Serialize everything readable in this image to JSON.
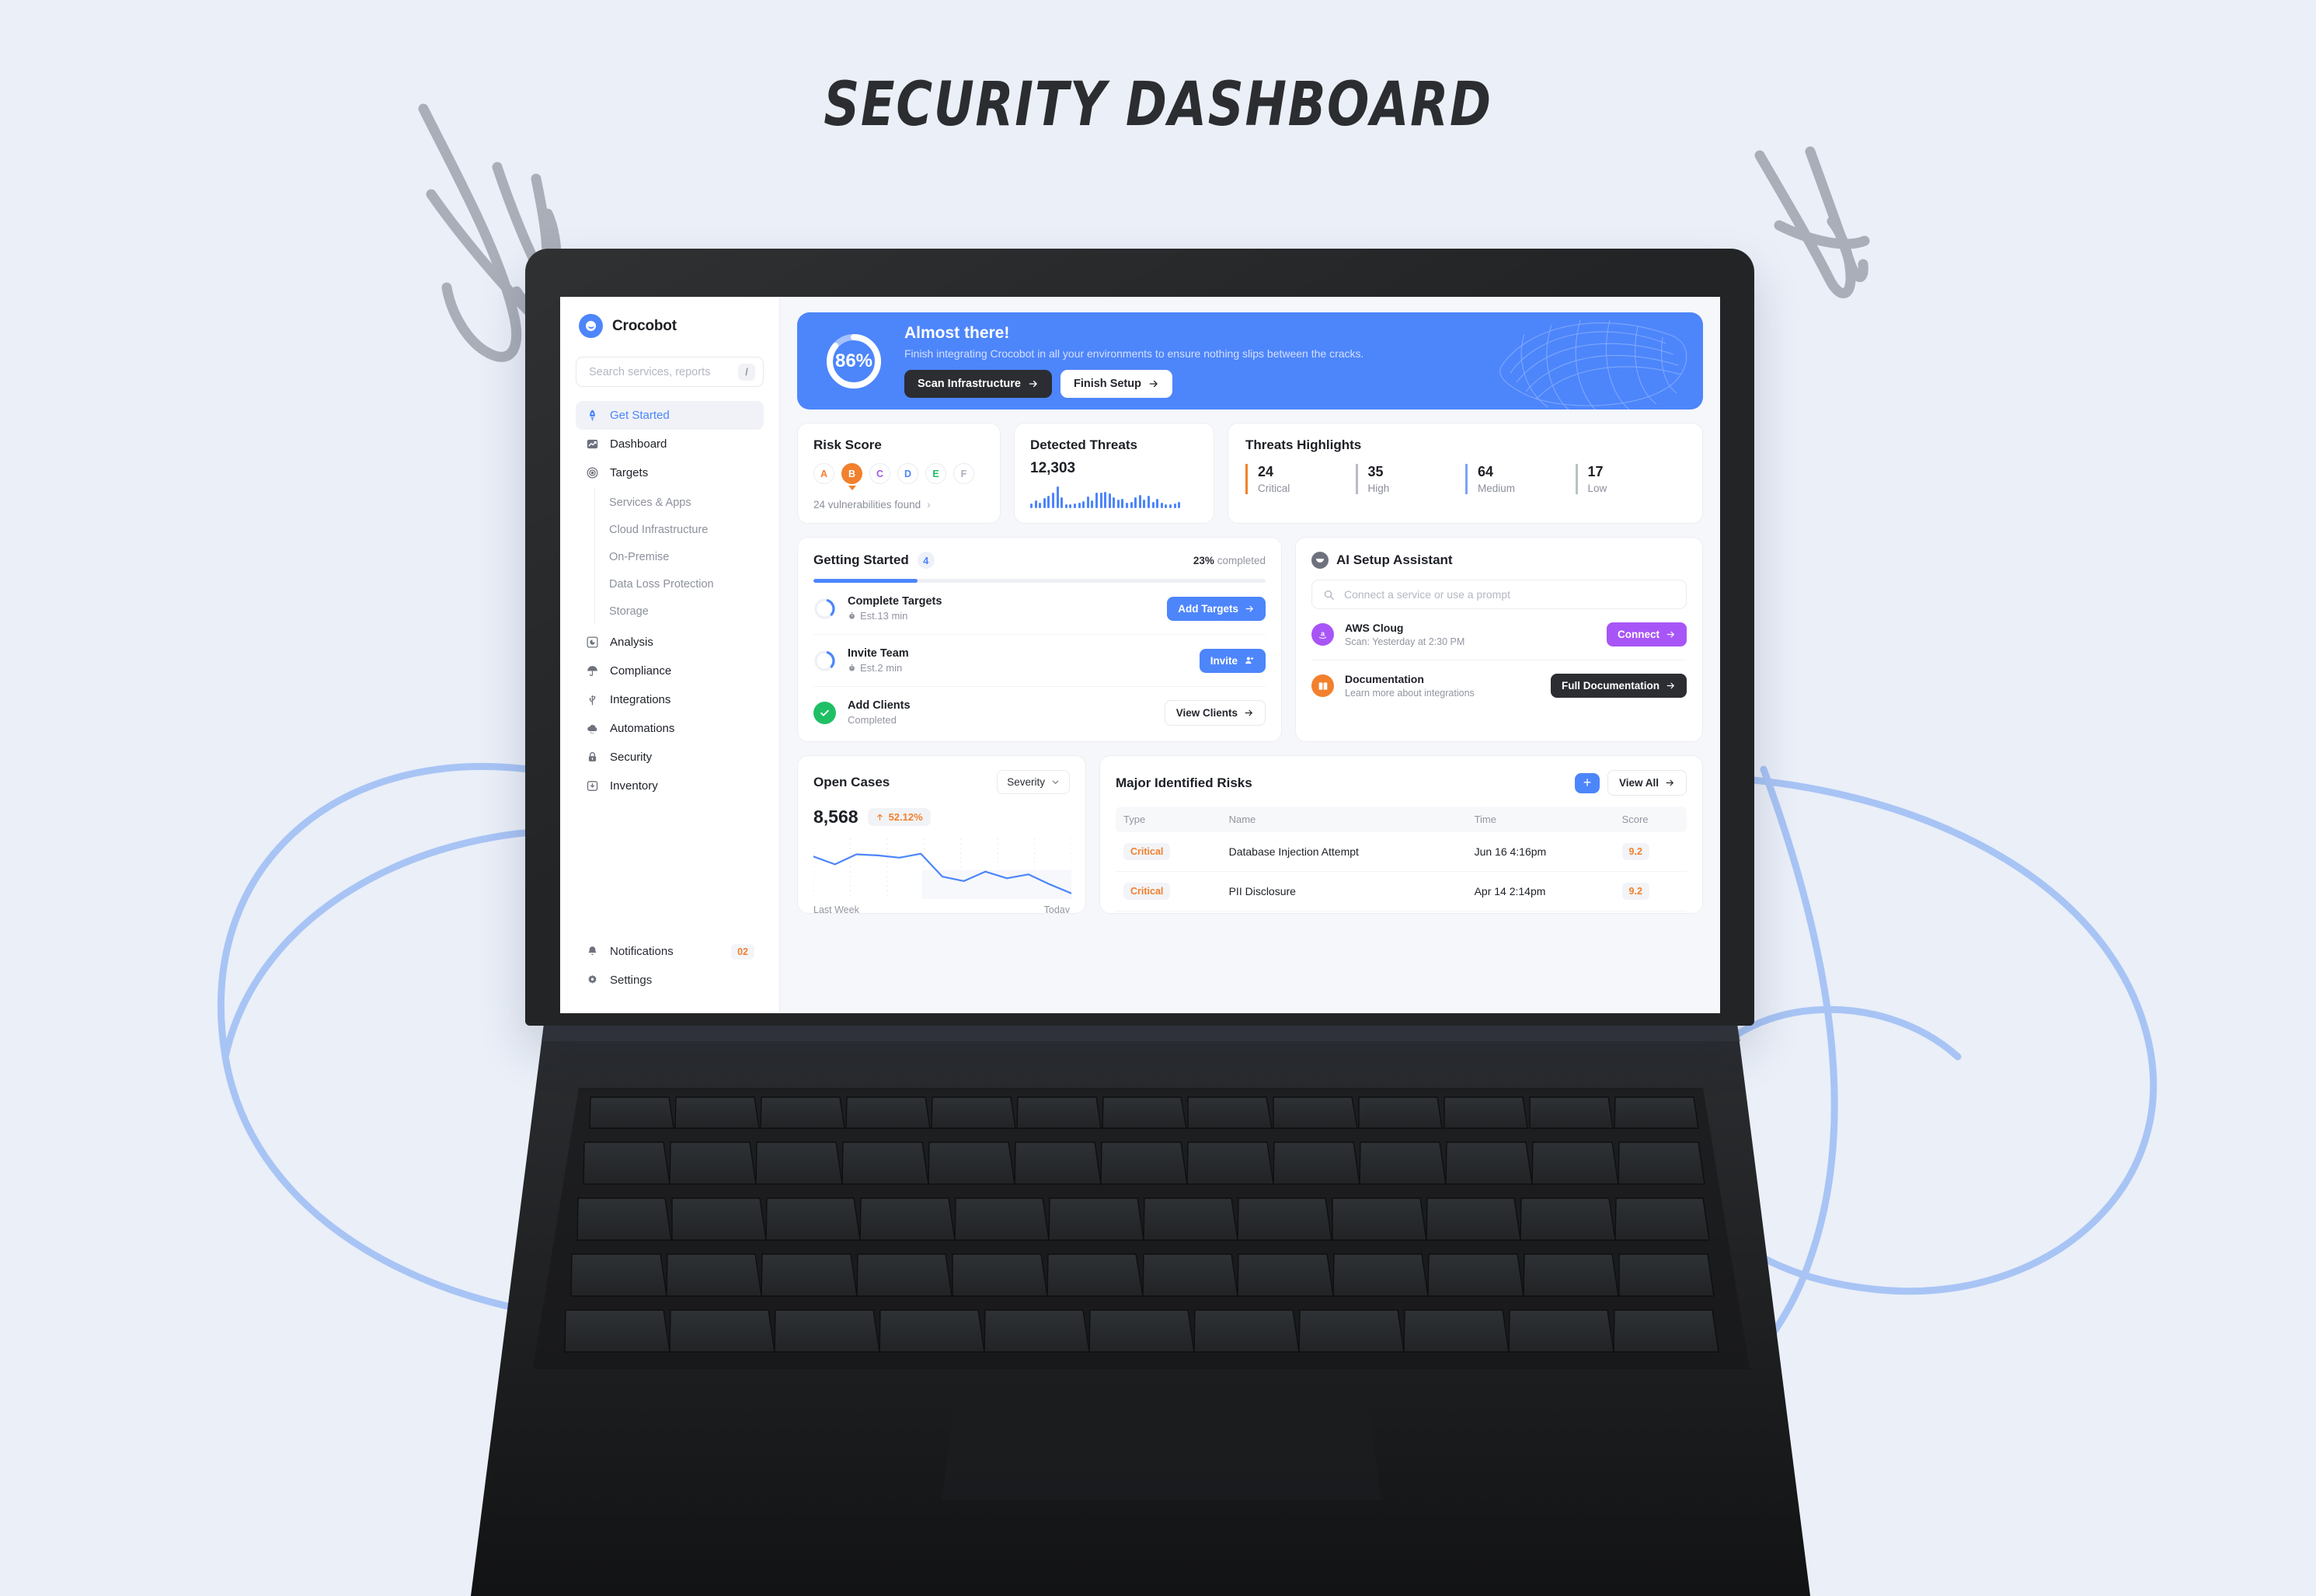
{
  "page": {
    "title": "SECURITY DASHBOARD"
  },
  "colors": {
    "accent_blue": "#4d85fb",
    "dark": "#2b2d32",
    "orange": "#f2802c",
    "green": "#1fc065",
    "purple": "#a855f7",
    "page_bg": "#eaeff8",
    "decor_line": "#a8c4f5"
  },
  "sidebar": {
    "brand": "Crocobot",
    "search": {
      "placeholder": "Search services, reports",
      "value": "",
      "shortcut": "/"
    },
    "items": [
      {
        "label": "Get Started",
        "icon": "rocket-icon",
        "active": true
      },
      {
        "label": "Dashboard",
        "icon": "chart-icon",
        "active": false
      },
      {
        "label": "Targets",
        "icon": "target-icon",
        "active": false
      }
    ],
    "subitems": [
      {
        "label": "Services & Apps"
      },
      {
        "label": "Cloud Infrastructure"
      },
      {
        "label": "On-Premise"
      },
      {
        "label": "Data Loss Protection"
      },
      {
        "label": "Storage"
      }
    ],
    "items2": [
      {
        "label": "Analysis",
        "icon": "pie-icon"
      },
      {
        "label": "Compliance",
        "icon": "umbrella-icon"
      },
      {
        "label": "Integrations",
        "icon": "usb-icon"
      },
      {
        "label": "Automations",
        "icon": "cloud-icon"
      },
      {
        "label": "Security",
        "icon": "lock-icon"
      },
      {
        "label": "Inventory",
        "icon": "inbox-icon"
      }
    ],
    "bottom": [
      {
        "label": "Notifications",
        "icon": "bell-icon",
        "badge": "02"
      },
      {
        "label": "Settings",
        "icon": "gear-icon",
        "badge": ""
      }
    ]
  },
  "banner": {
    "percent": "86%",
    "percent_value": 86,
    "title": "Almost there!",
    "subtitle": "Finish integrating Crocobot in all your environments to ensure nothing slips between the cracks.",
    "primary_button": "Scan Infrastructure",
    "secondary_button": "Finish Setup"
  },
  "risk_score": {
    "title": "Risk Score",
    "grades": [
      {
        "letter": "A",
        "color": "#f2802c",
        "selected": false
      },
      {
        "letter": "B",
        "color": "#f2802c",
        "selected": true
      },
      {
        "letter": "C",
        "color": "#9b5de5",
        "selected": false
      },
      {
        "letter": "D",
        "color": "#4d85fb",
        "selected": false
      },
      {
        "letter": "E",
        "color": "#1fc065",
        "selected": false
      },
      {
        "letter": "F",
        "color": "#a9adb8",
        "selected": false
      }
    ],
    "footer": "24 vulnerabilities found"
  },
  "detected_threats": {
    "title": "Detected Threats",
    "value": "12,303"
  },
  "threats_highlights": {
    "title": "Threats Highlights",
    "items": [
      {
        "count": "24",
        "label": "Critical",
        "color": "#f2802c"
      },
      {
        "count": "35",
        "label": "High",
        "color": "#b9bcc4"
      },
      {
        "count": "64",
        "label": "Medium",
        "color": "#7aa5f7"
      },
      {
        "count": "17",
        "label": "Low",
        "color": "#b9c4bd"
      }
    ]
  },
  "getting_started": {
    "title": "Getting Started",
    "count": "4",
    "completed_pct": "23%",
    "completed_label": "completed",
    "progress_value": 23,
    "items": [
      {
        "name": "Complete Targets",
        "meta": "Est.13 min",
        "meta_icon": "timer-icon",
        "state": "pending",
        "button": "Add Targets",
        "button_style": "blue",
        "button_icon": "arrow-right-icon"
      },
      {
        "name": "Invite Team",
        "meta": "Est.2 min",
        "meta_icon": "timer-icon",
        "state": "pending",
        "button": "Invite",
        "button_style": "blue",
        "button_icon": "user-plus-icon"
      },
      {
        "name": "Add Clients",
        "meta": "Completed",
        "meta_icon": "",
        "state": "completed",
        "button": "View Clients",
        "button_style": "outline",
        "button_icon": "arrow-right-icon"
      }
    ]
  },
  "ai_assistant": {
    "title": "AI Setup Assistant",
    "search": {
      "placeholder": "Connect a service or use a prompt",
      "value": ""
    },
    "items": [
      {
        "name": "AWS Cloug",
        "sub": "Scan: Yesterday at 2:30 PM",
        "avatar_color": "#a855f7",
        "avatar_icon": "amazon-icon",
        "button": "Connect",
        "button_style": "purple"
      },
      {
        "name": "Documentation",
        "sub": "Learn more about integrations",
        "avatar_color": "#f2802c",
        "avatar_icon": "book-icon",
        "button": "Full Documentation",
        "button_style": "dark"
      }
    ]
  },
  "open_cases": {
    "title": "Open Cases",
    "filter": "Severity",
    "value": "8,568",
    "delta": "52.12%",
    "delta_direction": "up",
    "axis_start": "Last Week",
    "axis_end": "Today"
  },
  "major_risks": {
    "title": "Major Identified Risks",
    "add_label": "+",
    "view_all": "View All",
    "columns": [
      "Type",
      "Name",
      "Time",
      "Score"
    ],
    "rows": [
      {
        "type": "Critical",
        "name": "Database Injection Attempt",
        "time": "Jun 16 4:16pm",
        "score": "9.2"
      },
      {
        "type": "Critical",
        "name": "PII Disclosure",
        "time": "Apr 14 2:14pm",
        "score": "9.2"
      }
    ]
  },
  "chart_data": [
    {
      "type": "bar",
      "title": "Detected Threats",
      "values": [
        6,
        10,
        7,
        13,
        16,
        20,
        28,
        14,
        5,
        5,
        6,
        7,
        9,
        15,
        10,
        20,
        20,
        21,
        19,
        14,
        11,
        12,
        7,
        8,
        14,
        17,
        11,
        16,
        8,
        12,
        7,
        5,
        5,
        6,
        8
      ],
      "ylim": [
        0,
        30
      ],
      "grid": false
    },
    {
      "type": "line",
      "title": "Open Cases",
      "x": [
        "Last Week",
        "",
        "",
        "",
        "",
        "",
        "Today"
      ],
      "values": [
        72,
        58,
        76,
        74,
        70,
        77,
        36,
        28,
        45,
        33,
        40,
        22,
        6
      ],
      "ylim": [
        0,
        100
      ],
      "grid": true,
      "xlabel": "",
      "ylabel": ""
    }
  ]
}
